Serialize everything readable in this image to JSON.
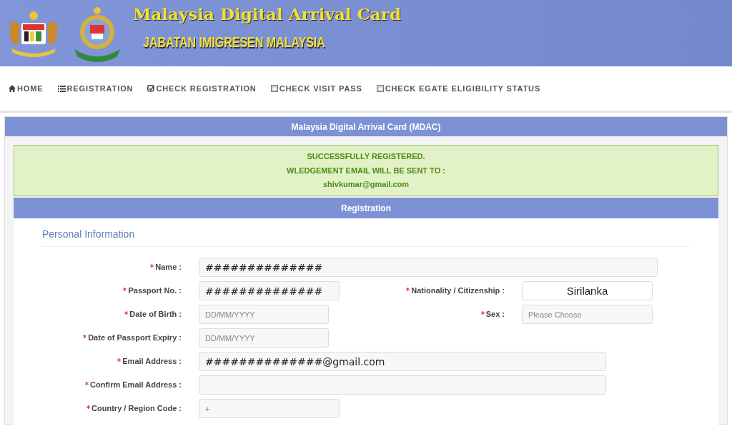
{
  "header": {
    "title": "Malaysia Digital Arrival Card",
    "subtitle": "JABATAN IMIGRESEN MALAYSIA"
  },
  "nav": [
    {
      "label": "HOME"
    },
    {
      "label": "REGISTRATION"
    },
    {
      "label": "CHECK REGISTRATION"
    },
    {
      "label": "CHECK VISIT PASS"
    },
    {
      "label": "CHECK EGATE ELIGIBILITY STATUS"
    }
  ],
  "panel_title": "Malaysia Digital Arrival Card (MDAC)",
  "success": {
    "lines": [
      "SUCCESSFULLY REGISTERED.",
      "WLEDGEMENT EMAIL WILL BE SENT TO :",
      "shivkumar@gmail.com"
    ]
  },
  "section_title": "Registration",
  "subsection": "Personal Information",
  "form_rows": [
    {
      "fields": [
        {
          "label": "Name :",
          "required": true,
          "value": "##############"
        }
      ]
    },
    {
      "fields": [
        {
          "label": "Passport No. :",
          "required": true,
          "value": "##############"
        },
        {
          "label": "Nationality / Citizenship :",
          "required": true,
          "value": "Sirilanka"
        }
      ]
    },
    {
      "fields": [
        {
          "label": "Date of Birth :",
          "required": true,
          "placeholder": "DD/MM/YYYY"
        },
        {
          "label": "Sex :",
          "required": true,
          "placeholder": "Please Choose"
        }
      ]
    },
    {
      "fields": [
        {
          "label": "Date of Passport Expiry :",
          "required": true,
          "placeholder": "DD/MM/YYYY"
        }
      ]
    },
    {
      "fields": [
        {
          "label": "Email Address :",
          "required": true,
          "value": "##############@gmail.com"
        }
      ]
    },
    {
      "fields": [
        {
          "label": "Confirm Email Address :",
          "required": true
        }
      ]
    },
    {
      "fields": [
        {
          "label": "Country / Region Code :",
          "required": true,
          "placeholder": "+"
        }
      ]
    }
  ]
}
